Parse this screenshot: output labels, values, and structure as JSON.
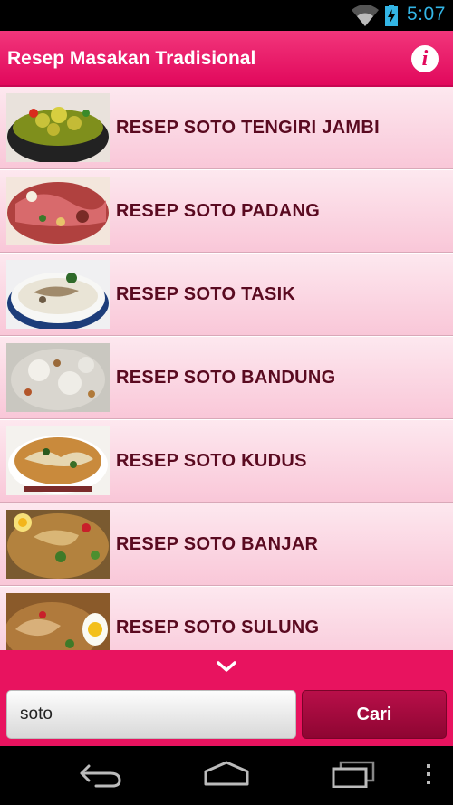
{
  "status_bar": {
    "time": "5:07",
    "icons": [
      "wifi-icon",
      "battery-charging-icon"
    ]
  },
  "action_bar": {
    "title": "Resep Masakan Tradisional",
    "info_icon": "info-icon",
    "info_glyph": "i"
  },
  "recipes": [
    {
      "label": "RESEP SOTO TENGIRI JAMBI"
    },
    {
      "label": "RESEP SOTO PADANG"
    },
    {
      "label": "RESEP SOTO TASIK"
    },
    {
      "label": "RESEP SOTO BANDUNG"
    },
    {
      "label": "RESEP SOTO KUDUS"
    },
    {
      "label": "RESEP SOTO BANJAR"
    },
    {
      "label": "RESEP SOTO SULUNG"
    }
  ],
  "search": {
    "value": "soto",
    "button_label": "Cari"
  },
  "nav_bar": {
    "icons": [
      "back-icon",
      "home-icon",
      "recent-apps-icon",
      "menu-icon"
    ]
  },
  "colors": {
    "accent": "#e8135f",
    "row_text": "#5a0a20",
    "clock": "#33b5e5",
    "button": "#a00a3e"
  }
}
